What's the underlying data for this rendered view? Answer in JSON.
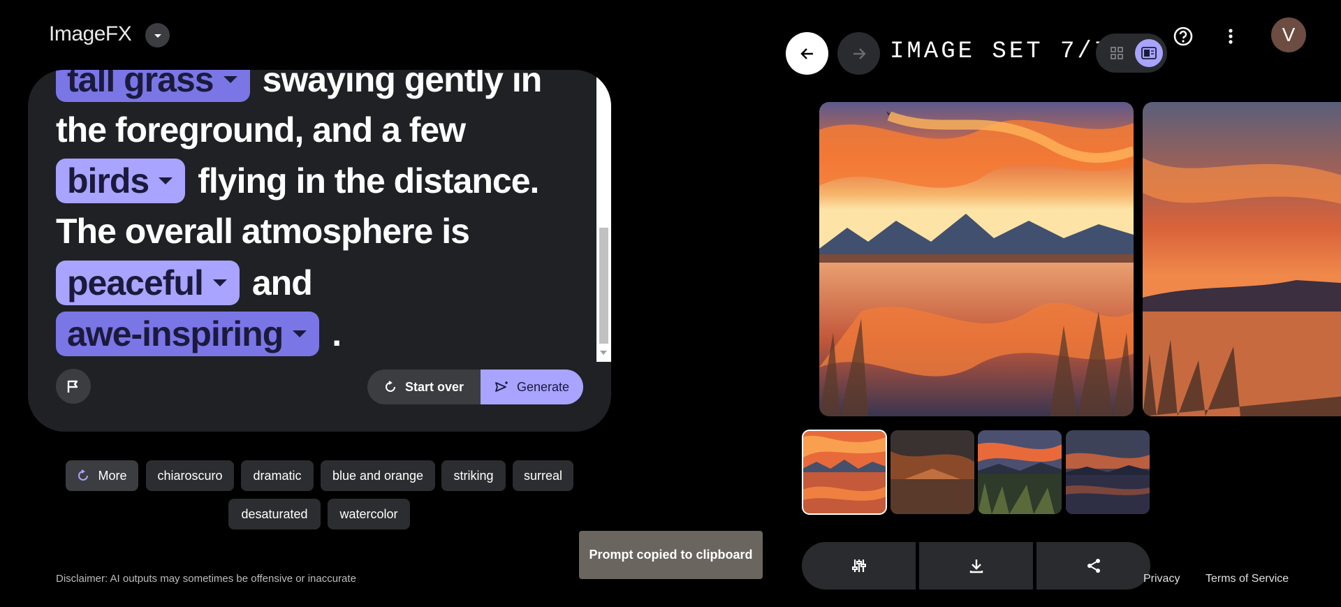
{
  "app": {
    "title": "ImageFX"
  },
  "prompt": {
    "lines": [
      {
        "chip": "tall grass",
        "text": "swaying gently in"
      },
      {
        "text": "the foreground, and a few"
      },
      {
        "chip": "birds",
        "text": "flying in the distance."
      },
      {
        "text": "The overall atmosphere is"
      },
      {
        "chip": "peaceful",
        "text": "and"
      },
      {
        "chip": "awe-inspiring",
        "text": "."
      }
    ],
    "start_over_label": "Start over",
    "generate_label": "Generate"
  },
  "suggestions": {
    "more_label": "More",
    "chips": [
      "chiaroscuro",
      "dramatic",
      "blue and orange",
      "striking",
      "surreal",
      "desaturated",
      "watercolor"
    ]
  },
  "disclaimer": "Disclaimer: AI outputs may sometimes be offensive or inaccurate",
  "toast": "Prompt copied to clipboard",
  "viewer": {
    "set_label": "IMAGE SET 7/7",
    "avatar_initial": "V",
    "selected_thumbnail": 1,
    "thumbnail_count": 4
  },
  "footer": {
    "privacy": "Privacy",
    "terms": "Terms of Service"
  },
  "icons": {
    "logo_menu": "chevron-down-icon",
    "flag": "flag-icon",
    "start_over": "refresh-icon",
    "generate": "send-sparkle-icon",
    "back": "arrow-left-icon",
    "forward": "arrow-right-icon",
    "grid_view": "grid-icon",
    "single_view": "single-image-icon",
    "help": "help-icon",
    "menu": "more-vert-icon",
    "edit": "tune-icon",
    "download": "download-icon",
    "share": "share-icon"
  },
  "colors": {
    "accent": "#a8a4ff",
    "chip_dim": "#7b76e6",
    "card": "#202124"
  }
}
